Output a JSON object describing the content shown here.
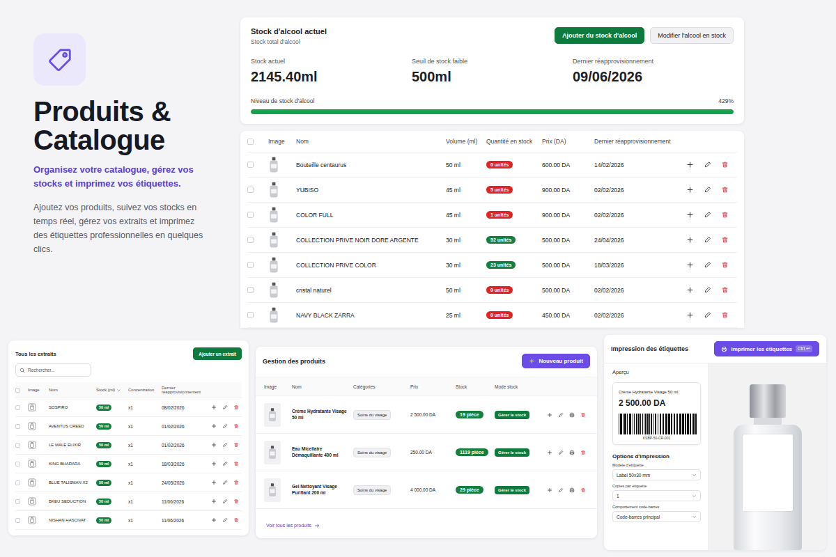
{
  "hero": {
    "title": "Produits & Catalogue",
    "subtitle": "Organisez votre catalogue, gérez vos stocks et imprimez vos étiquettes.",
    "description": "Ajoutez vos produits, suivez vos stocks en temps réel, gérez vos extraits et imprimez des étiquettes professionnelles en quelques clics."
  },
  "alcohol_stock": {
    "title": "Stock d'alcool actuel",
    "subtitle": "Stock total d'alcool",
    "buttons": [
      {
        "label": "Ajouter du stock d'alcool",
        "primary": true
      },
      {
        "label": "Modifier l'alcool en stock",
        "primary": false
      }
    ],
    "stats": [
      {
        "label": "Stock actuel",
        "value": "2145.40ml"
      },
      {
        "label": "Seuil de stock faible",
        "value": "500ml"
      },
      {
        "label": "Dernier réapprovisionnement",
        "value": "09/06/2026"
      }
    ],
    "level_label": "Niveau de stock d'alcool",
    "level": 1,
    "reading": "429%"
  },
  "stock_table": {
    "select_all": false,
    "columns": [
      "Image",
      "Nom",
      "Volume (ml)",
      "Quantité en stock",
      "Prix (DA)",
      "Dernier réapprovisionnement"
    ],
    "rows": [
      {
        "name": "Bouteille centaurus",
        "volume": "50 ml",
        "quantity": "0 unités",
        "color": "#e02424",
        "price": "600.00 DA",
        "date": "14/02/2026",
        "checked": false
      },
      {
        "name": "YUBISO",
        "volume": "45 ml",
        "quantity": "5 unités",
        "color": "#e02424",
        "price": "900.00 DA",
        "date": "02/02/2026",
        "checked": false
      },
      {
        "name": "COLOR FULL",
        "volume": "45 ml",
        "quantity": "1 unités",
        "color": "#e02424",
        "price": "900.00 DA",
        "date": "02/02/2026",
        "checked": false
      },
      {
        "name": "COLLECTION PRIVE NOIR DORE ARGENTE",
        "volume": "30 ml",
        "quantity": "52 unités",
        "color": "#15803d",
        "price": "500.00 DA",
        "date": "24/04/2026",
        "checked": false
      },
      {
        "name": "COLLECTION PRIVE COLOR",
        "volume": "30 ml",
        "quantity": "23 unités",
        "color": "#15803d",
        "price": "500.00 DA",
        "date": "18/03/2026",
        "checked": false
      },
      {
        "name": "cristal naturel",
        "volume": "50 ml",
        "quantity": "0 unités",
        "color": "#e02424",
        "price": "500.00 DA",
        "date": "02/02/2026",
        "checked": false
      },
      {
        "name": "NAVY BLACK ZARRA",
        "volume": "25 ml",
        "quantity": "0 unités",
        "color": "#e02424",
        "price": "450.00 DA",
        "date": "02/02/2026",
        "checked": false
      }
    ]
  },
  "extracts": {
    "title": "Tous les extraits",
    "add_button": "Ajouter un extrait",
    "search_placeholder": "Rechercher...",
    "select_all": false,
    "columns": [
      {
        "label": "Image",
        "sortable": false
      },
      {
        "label": "Nom",
        "sortable": false
      },
      {
        "label": "Stock (ml)",
        "sortable": true
      },
      {
        "label": "Concentration",
        "sortable": false
      },
      {
        "label": "Dernier réapprovisionnement",
        "sortable": false
      }
    ],
    "rows": [
      {
        "name": "SOSPIRO",
        "stock": "50 ml",
        "concentration": "x1",
        "date": "08/02/2026",
        "checked": false
      },
      {
        "name": "AVENTUS CREED",
        "stock": "50 ml",
        "concentration": "x1",
        "date": "01/02/2026",
        "checked": false
      },
      {
        "name": "LE MALE ELIXIR",
        "stock": "50 ml",
        "concentration": "x1",
        "date": "01/02/2026",
        "checked": false
      },
      {
        "name": "KING BHARARA",
        "stock": "50 ml",
        "concentration": "x1",
        "date": "18/03/2026",
        "checked": false
      },
      {
        "name": "BLUE TALISMAN X2",
        "stock": "50 ml",
        "concentration": "x1",
        "date": "24/05/2026",
        "checked": false
      },
      {
        "name": "BKEU SEDUCTION",
        "stock": "50 ml",
        "concentration": "x1",
        "date": "11/06/2026",
        "checked": false
      },
      {
        "name": "NISHAN HASCIVAT",
        "stock": "50 ml",
        "concentration": "x1",
        "date": "11/06/2026",
        "checked": false
      }
    ]
  },
  "products": {
    "title": "Gestion des produits",
    "new_button": "Nouveau produit",
    "columns": [
      "Image",
      "Nom",
      "Catégories",
      "Prix",
      "Stock",
      "Mode stock"
    ],
    "rows": [
      {
        "name": "Crème Hydratante Visage 50 ml",
        "category": "Soins du visage",
        "price": "2 500.00 DA",
        "stock": "19 pièce",
        "mode": "Gérer le stock"
      },
      {
        "name": "Eau Micellaire Démaquillante 400 ml",
        "category": "Soins du visage",
        "price": "250.00 DA",
        "stock": "1119 pièce",
        "mode": "Gérer le stock"
      },
      {
        "name": "Gel Nettoyant Visage Purifiant 200 ml",
        "category": "Soins du visage",
        "price": "4 000.00 DA",
        "stock": "29 pièce",
        "mode": "Gérer le stock"
      }
    ],
    "footer_link": "Voir tous les produits"
  },
  "labels": {
    "title": "Impression des étiquettes",
    "print_button": "Imprimer les étiquettes",
    "shortcut": "Ctrl ↵",
    "preview_title": "Aperçu",
    "preview": {
      "name": "Crème Hydratante Visage 50 ml",
      "price": "2 500.00 DA",
      "barcode": "KSBP-50-CR-001"
    },
    "options_title": "Options d'impression",
    "fields": [
      {
        "label": "Modèle d'étiquette",
        "value": "Label 50x30 mm"
      },
      {
        "label": "Copies par étiquette",
        "value": "1"
      },
      {
        "label": "Comportement code-barres",
        "value": "Code-barres principal"
      }
    ]
  }
}
